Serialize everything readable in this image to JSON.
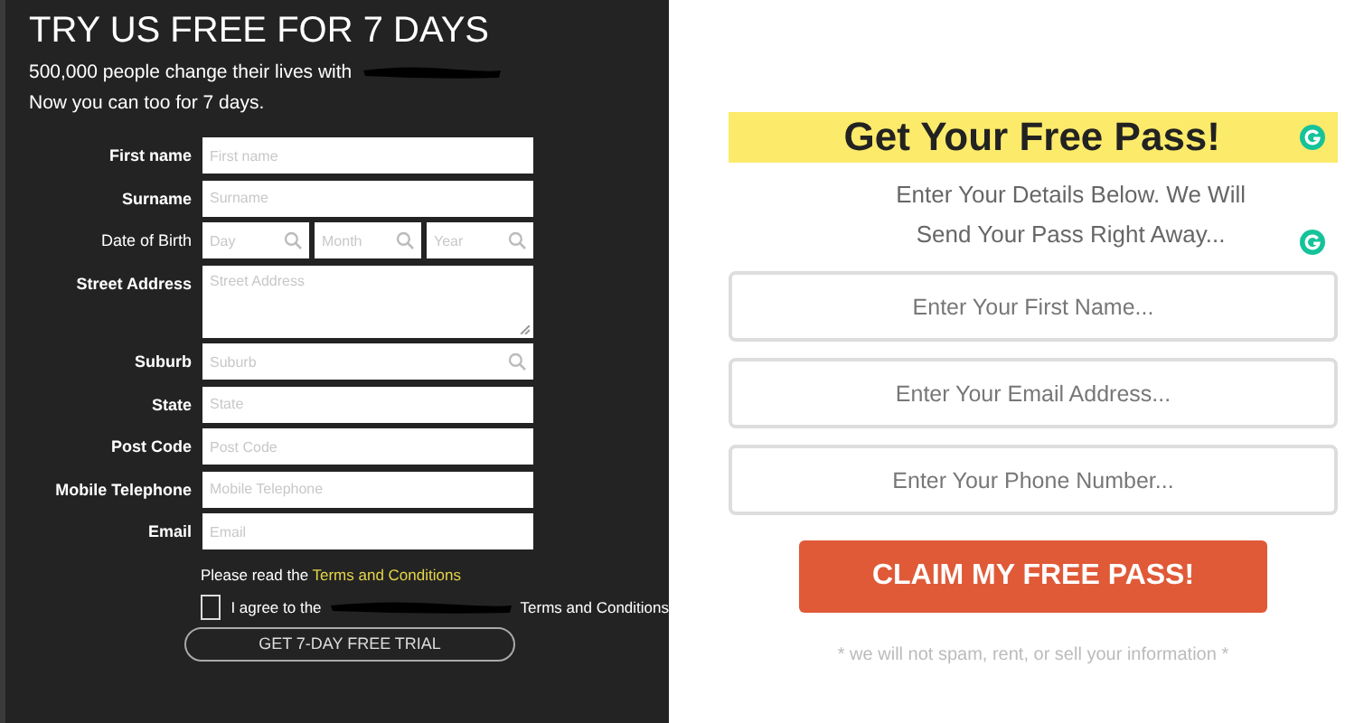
{
  "trial_form": {
    "title": "TRY US FREE FOR 7 DAYS",
    "intro": [
      {
        "text": "500,000 people change their lives with",
        "redacted": true
      },
      {
        "text": "Now you can too for 7 days.",
        "redacted": false
      }
    ],
    "fields": [
      {
        "label": "First name",
        "kind": "text",
        "placeholder": "First name"
      },
      {
        "label": "Surname",
        "kind": "text",
        "placeholder": "Surname"
      },
      {
        "label": "Date of Birth",
        "kind": "split",
        "parts": [
          {
            "placeholder": "Day"
          },
          {
            "placeholder": "Month"
          },
          {
            "placeholder": "Year"
          }
        ]
      },
      {
        "label": "Street Address",
        "kind": "textarea",
        "placeholder": "Street Address"
      },
      {
        "label": "Suburb",
        "kind": "search",
        "placeholder": "Suburb"
      },
      {
        "label": "State",
        "kind": "text",
        "placeholder": "State"
      },
      {
        "label": "Post Code",
        "kind": "text",
        "placeholder": "Post Code"
      },
      {
        "label": "Mobile Telephone",
        "kind": "text",
        "placeholder": "Mobile Telephone"
      },
      {
        "label": "Email",
        "kind": "text",
        "placeholder": "Email"
      }
    ],
    "terms_note": {
      "text": "Please read the",
      "link": "Terms and Conditions"
    },
    "agree": {
      "checked": false,
      "text_before": "I agree to the",
      "text_after": "Terms and Conditions"
    },
    "button": "GET 7-DAY FREE TRIAL"
  },
  "pass_form": {
    "title": "Get Your Free Pass!",
    "subtitle": [
      "Enter Your Details Below. We Will",
      "Send Your Pass Right Away..."
    ],
    "fields": [
      {
        "placeholder": "Enter Your First Name..."
      },
      {
        "placeholder": "Enter Your Email Address..."
      },
      {
        "placeholder": "Enter Your Phone Number..."
      }
    ],
    "button": "CLAIM MY FREE PASS!",
    "note": "* we will not spam, rent, or sell your information *"
  }
}
